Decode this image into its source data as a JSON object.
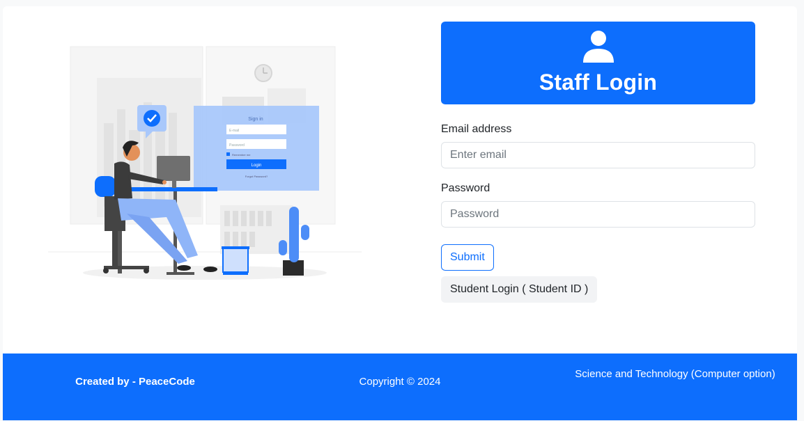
{
  "header": {
    "title": "Staff Login",
    "icon": "user-icon"
  },
  "form": {
    "email_label": "Email address",
    "email_placeholder": "Enter email",
    "email_value": "",
    "password_label": "Password",
    "password_placeholder": "Password",
    "password_value": "",
    "submit_label": "Submit",
    "student_login_label": "Student Login ( Student ID )"
  },
  "illustration": {
    "signin_title": "Sign in",
    "email_placeholder": "E-mail",
    "password_placeholder": "Password",
    "remember_label": "Remember me",
    "login_label": "Login",
    "forgot_label": "Forgot Password?"
  },
  "footer": {
    "credit": "Created by - PeaceCode",
    "copyright": "Copyright © 2024",
    "department": "Science and Technology (Computer option)"
  },
  "colors": {
    "primary": "#0d6efd",
    "background": "#f8f9fa",
    "card": "#ffffff"
  }
}
